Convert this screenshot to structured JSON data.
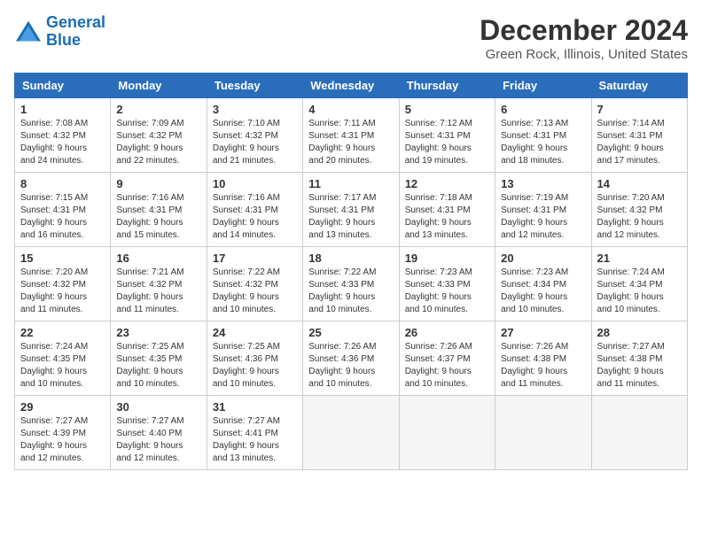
{
  "logo": {
    "line1": "General",
    "line2": "Blue"
  },
  "title": "December 2024",
  "subtitle": "Green Rock, Illinois, United States",
  "days_header": [
    "Sunday",
    "Monday",
    "Tuesday",
    "Wednesday",
    "Thursday",
    "Friday",
    "Saturday"
  ],
  "weeks": [
    [
      {
        "day": "1",
        "info": "Sunrise: 7:08 AM\nSunset: 4:32 PM\nDaylight: 9 hours\nand 24 minutes."
      },
      {
        "day": "2",
        "info": "Sunrise: 7:09 AM\nSunset: 4:32 PM\nDaylight: 9 hours\nand 22 minutes."
      },
      {
        "day": "3",
        "info": "Sunrise: 7:10 AM\nSunset: 4:32 PM\nDaylight: 9 hours\nand 21 minutes."
      },
      {
        "day": "4",
        "info": "Sunrise: 7:11 AM\nSunset: 4:31 PM\nDaylight: 9 hours\nand 20 minutes."
      },
      {
        "day": "5",
        "info": "Sunrise: 7:12 AM\nSunset: 4:31 PM\nDaylight: 9 hours\nand 19 minutes."
      },
      {
        "day": "6",
        "info": "Sunrise: 7:13 AM\nSunset: 4:31 PM\nDaylight: 9 hours\nand 18 minutes."
      },
      {
        "day": "7",
        "info": "Sunrise: 7:14 AM\nSunset: 4:31 PM\nDaylight: 9 hours\nand 17 minutes."
      }
    ],
    [
      {
        "day": "8",
        "info": "Sunrise: 7:15 AM\nSunset: 4:31 PM\nDaylight: 9 hours\nand 16 minutes."
      },
      {
        "day": "9",
        "info": "Sunrise: 7:16 AM\nSunset: 4:31 PM\nDaylight: 9 hours\nand 15 minutes."
      },
      {
        "day": "10",
        "info": "Sunrise: 7:16 AM\nSunset: 4:31 PM\nDaylight: 9 hours\nand 14 minutes."
      },
      {
        "day": "11",
        "info": "Sunrise: 7:17 AM\nSunset: 4:31 PM\nDaylight: 9 hours\nand 13 minutes."
      },
      {
        "day": "12",
        "info": "Sunrise: 7:18 AM\nSunset: 4:31 PM\nDaylight: 9 hours\nand 13 minutes."
      },
      {
        "day": "13",
        "info": "Sunrise: 7:19 AM\nSunset: 4:31 PM\nDaylight: 9 hours\nand 12 minutes."
      },
      {
        "day": "14",
        "info": "Sunrise: 7:20 AM\nSunset: 4:32 PM\nDaylight: 9 hours\nand 12 minutes."
      }
    ],
    [
      {
        "day": "15",
        "info": "Sunrise: 7:20 AM\nSunset: 4:32 PM\nDaylight: 9 hours\nand 11 minutes."
      },
      {
        "day": "16",
        "info": "Sunrise: 7:21 AM\nSunset: 4:32 PM\nDaylight: 9 hours\nand 11 minutes."
      },
      {
        "day": "17",
        "info": "Sunrise: 7:22 AM\nSunset: 4:32 PM\nDaylight: 9 hours\nand 10 minutes."
      },
      {
        "day": "18",
        "info": "Sunrise: 7:22 AM\nSunset: 4:33 PM\nDaylight: 9 hours\nand 10 minutes."
      },
      {
        "day": "19",
        "info": "Sunrise: 7:23 AM\nSunset: 4:33 PM\nDaylight: 9 hours\nand 10 minutes."
      },
      {
        "day": "20",
        "info": "Sunrise: 7:23 AM\nSunset: 4:34 PM\nDaylight: 9 hours\nand 10 minutes."
      },
      {
        "day": "21",
        "info": "Sunrise: 7:24 AM\nSunset: 4:34 PM\nDaylight: 9 hours\nand 10 minutes."
      }
    ],
    [
      {
        "day": "22",
        "info": "Sunrise: 7:24 AM\nSunset: 4:35 PM\nDaylight: 9 hours\nand 10 minutes."
      },
      {
        "day": "23",
        "info": "Sunrise: 7:25 AM\nSunset: 4:35 PM\nDaylight: 9 hours\nand 10 minutes."
      },
      {
        "day": "24",
        "info": "Sunrise: 7:25 AM\nSunset: 4:36 PM\nDaylight: 9 hours\nand 10 minutes."
      },
      {
        "day": "25",
        "info": "Sunrise: 7:26 AM\nSunset: 4:36 PM\nDaylight: 9 hours\nand 10 minutes."
      },
      {
        "day": "26",
        "info": "Sunrise: 7:26 AM\nSunset: 4:37 PM\nDaylight: 9 hours\nand 10 minutes."
      },
      {
        "day": "27",
        "info": "Sunrise: 7:26 AM\nSunset: 4:38 PM\nDaylight: 9 hours\nand 11 minutes."
      },
      {
        "day": "28",
        "info": "Sunrise: 7:27 AM\nSunset: 4:38 PM\nDaylight: 9 hours\nand 11 minutes."
      }
    ],
    [
      {
        "day": "29",
        "info": "Sunrise: 7:27 AM\nSunset: 4:39 PM\nDaylight: 9 hours\nand 12 minutes."
      },
      {
        "day": "30",
        "info": "Sunrise: 7:27 AM\nSunset: 4:40 PM\nDaylight: 9 hours\nand 12 minutes."
      },
      {
        "day": "31",
        "info": "Sunrise: 7:27 AM\nSunset: 4:41 PM\nDaylight: 9 hours\nand 13 minutes."
      },
      {
        "day": "",
        "info": ""
      },
      {
        "day": "",
        "info": ""
      },
      {
        "day": "",
        "info": ""
      },
      {
        "day": "",
        "info": ""
      }
    ]
  ]
}
